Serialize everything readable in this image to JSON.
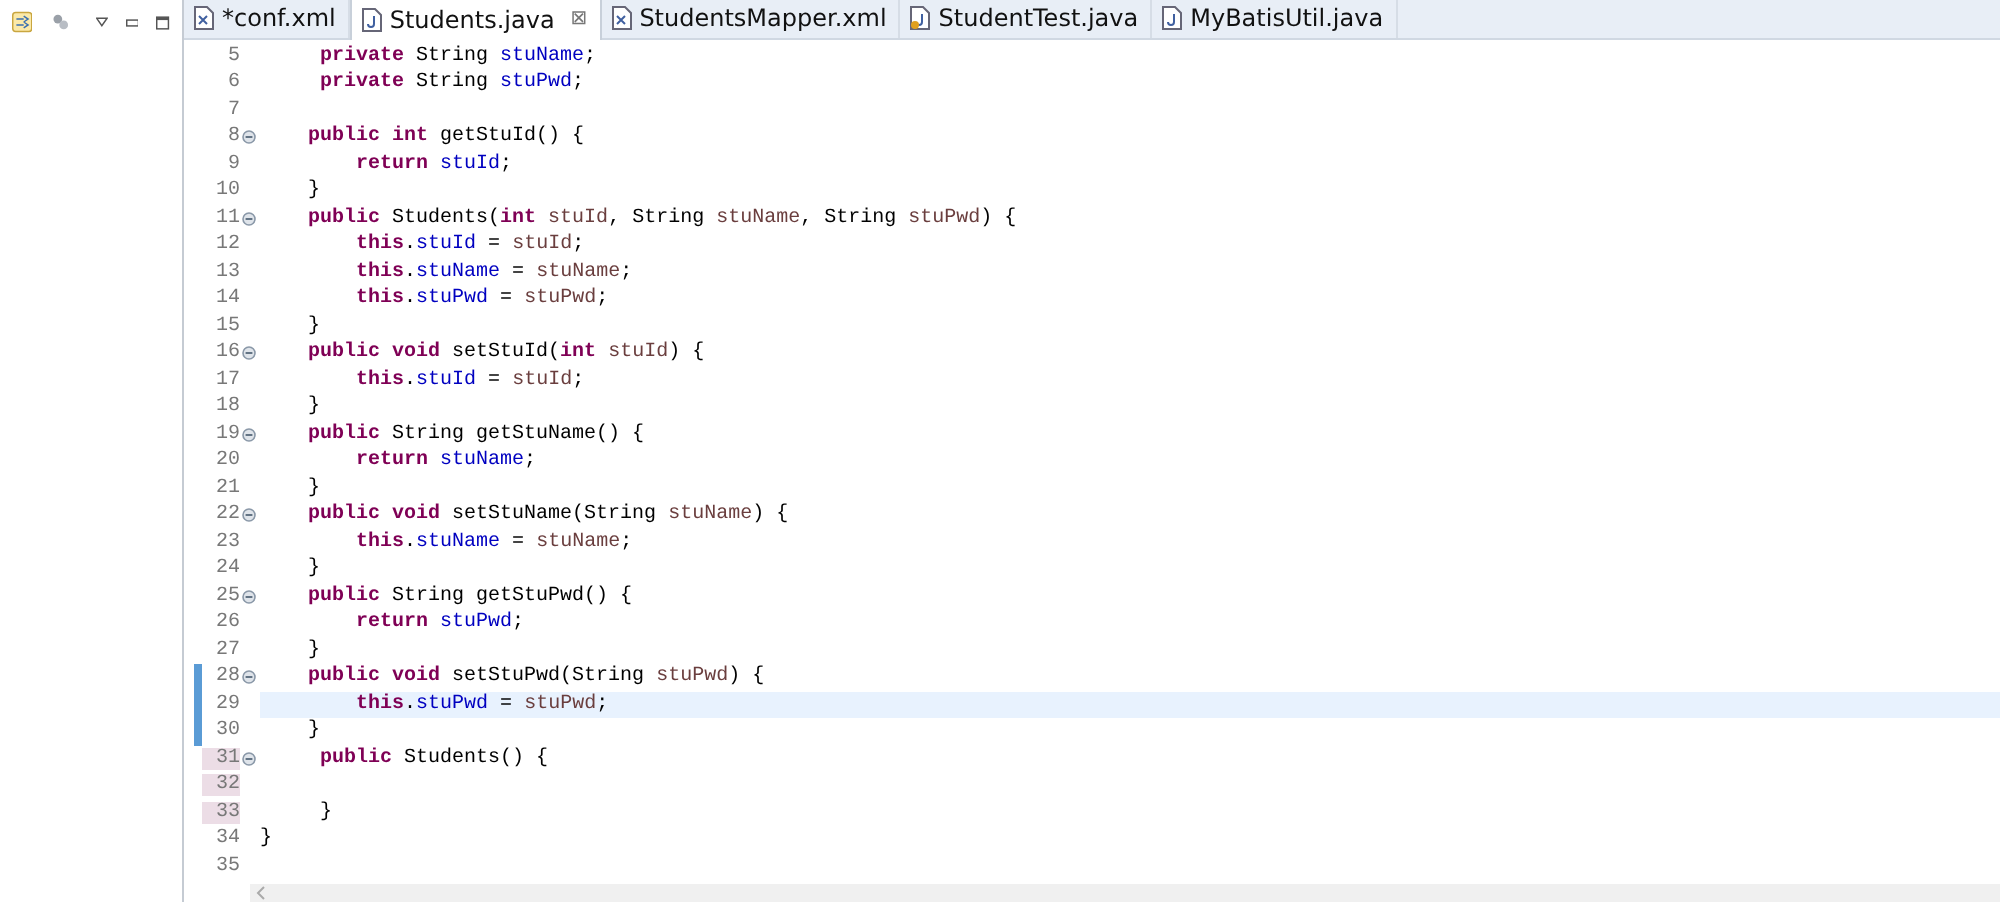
{
  "tabs": [
    {
      "label": "*conf.xml",
      "kind": "xml",
      "selected": false
    },
    {
      "label": "Students.java",
      "kind": "java",
      "selected": true
    },
    {
      "label": "StudentsMapper.xml",
      "kind": "xml",
      "selected": false
    },
    {
      "label": "StudentTest.java",
      "kind": "test",
      "selected": false
    },
    {
      "label": "MyBatisUtil.java",
      "kind": "java",
      "selected": false
    }
  ],
  "close_glyph": "⊠",
  "lines": [
    {
      "n": "5",
      "fold": false,
      "current": false,
      "code": [
        {
          "kind": "keyword",
          "text": "     private"
        },
        {
          "kind": "plain",
          "text": " String "
        },
        {
          "kind": "field",
          "text": "stuName"
        },
        {
          "kind": "plain",
          "text": ";"
        }
      ]
    },
    {
      "n": "6",
      "fold": false,
      "current": false,
      "code": [
        {
          "kind": "keyword",
          "text": "     private"
        },
        {
          "kind": "plain",
          "text": " String "
        },
        {
          "kind": "field",
          "text": "stuPwd"
        },
        {
          "kind": "plain",
          "text": ";"
        }
      ]
    },
    {
      "n": "7",
      "fold": false,
      "current": false
    },
    {
      "n": "8",
      "fold": true,
      "current": false,
      "code": [
        {
          "kind": "keyword",
          "text": "    public "
        },
        {
          "kind": "keyword",
          "text": "int"
        },
        {
          "kind": "plain",
          "text": " getStuId() {"
        }
      ]
    },
    {
      "n": "9",
      "fold": false,
      "current": false,
      "code": [
        {
          "kind": "keyword",
          "text": "        return "
        },
        {
          "kind": "field",
          "text": "stuId"
        },
        {
          "kind": "plain",
          "text": ";"
        }
      ]
    },
    {
      "n": "10",
      "fold": false,
      "current": false,
      "code": [
        {
          "kind": "plain",
          "text": "    }"
        }
      ]
    },
    {
      "n": "11",
      "fold": true,
      "current": false,
      "code": [
        {
          "kind": "keyword",
          "text": "    public"
        },
        {
          "kind": "plain",
          "text": " Students("
        },
        {
          "kind": "keyword",
          "text": "int "
        },
        {
          "kind": "variable",
          "text": "stuId"
        },
        {
          "kind": "plain",
          "text": ", String "
        },
        {
          "kind": "variable",
          "text": "stuName"
        },
        {
          "kind": "plain",
          "text": ", String "
        },
        {
          "kind": "variable",
          "text": "stuPwd"
        },
        {
          "kind": "plain",
          "text": ") {"
        }
      ]
    },
    {
      "n": "12",
      "fold": false,
      "current": false,
      "code": [
        {
          "kind": "keyword",
          "text": "        this"
        },
        {
          "kind": "plain",
          "text": "."
        },
        {
          "kind": "field",
          "text": "stuId"
        },
        {
          "kind": "plain",
          "text": " = "
        },
        {
          "kind": "variable",
          "text": "stuId"
        },
        {
          "kind": "plain",
          "text": ";"
        }
      ]
    },
    {
      "n": "13",
      "fold": false,
      "current": false,
      "code": [
        {
          "kind": "keyword",
          "text": "        this"
        },
        {
          "kind": "plain",
          "text": "."
        },
        {
          "kind": "field",
          "text": "stuName"
        },
        {
          "kind": "plain",
          "text": " = "
        },
        {
          "kind": "variable",
          "text": "stuName"
        },
        {
          "kind": "plain",
          "text": ";"
        }
      ]
    },
    {
      "n": "14",
      "fold": false,
      "current": false,
      "code": [
        {
          "kind": "keyword",
          "text": "        this"
        },
        {
          "kind": "plain",
          "text": "."
        },
        {
          "kind": "field",
          "text": "stuPwd"
        },
        {
          "kind": "plain",
          "text": " = "
        },
        {
          "kind": "variable",
          "text": "stuPwd"
        },
        {
          "kind": "plain",
          "text": ";"
        }
      ]
    },
    {
      "n": "15",
      "fold": false,
      "current": false,
      "code": [
        {
          "kind": "plain",
          "text": "    }"
        }
      ]
    },
    {
      "n": "16",
      "fold": true,
      "current": false,
      "code": [
        {
          "kind": "keyword",
          "text": "    public "
        },
        {
          "kind": "keyword",
          "text": "void"
        },
        {
          "kind": "plain",
          "text": " setStuId("
        },
        {
          "kind": "keyword",
          "text": "int "
        },
        {
          "kind": "variable",
          "text": "stuId"
        },
        {
          "kind": "plain",
          "text": ") {"
        }
      ]
    },
    {
      "n": "17",
      "fold": false,
      "current": false,
      "code": [
        {
          "kind": "keyword",
          "text": "        this"
        },
        {
          "kind": "plain",
          "text": "."
        },
        {
          "kind": "field",
          "text": "stuId"
        },
        {
          "kind": "plain",
          "text": " = "
        },
        {
          "kind": "variable",
          "text": "stuId"
        },
        {
          "kind": "plain",
          "text": ";"
        }
      ]
    },
    {
      "n": "18",
      "fold": false,
      "current": false,
      "code": [
        {
          "kind": "plain",
          "text": "    }"
        }
      ]
    },
    {
      "n": "19",
      "fold": true,
      "current": false,
      "code": [
        {
          "kind": "keyword",
          "text": "    public"
        },
        {
          "kind": "plain",
          "text": " String getStuName() {"
        }
      ]
    },
    {
      "n": "20",
      "fold": false,
      "current": false,
      "code": [
        {
          "kind": "keyword",
          "text": "        return "
        },
        {
          "kind": "field",
          "text": "stuName"
        },
        {
          "kind": "plain",
          "text": ";"
        }
      ]
    },
    {
      "n": "21",
      "fold": false,
      "current": false,
      "code": [
        {
          "kind": "plain",
          "text": "    }"
        }
      ]
    },
    {
      "n": "22",
      "fold": true,
      "current": false,
      "code": [
        {
          "kind": "keyword",
          "text": "    public "
        },
        {
          "kind": "keyword",
          "text": "void"
        },
        {
          "kind": "plain",
          "text": " setStuName(String "
        },
        {
          "kind": "variable",
          "text": "stuName"
        },
        {
          "kind": "plain",
          "text": ") {"
        }
      ]
    },
    {
      "n": "23",
      "fold": false,
      "current": false,
      "code": [
        {
          "kind": "keyword",
          "text": "        this"
        },
        {
          "kind": "plain",
          "text": "."
        },
        {
          "kind": "field",
          "text": "stuName"
        },
        {
          "kind": "plain",
          "text": " = "
        },
        {
          "kind": "variable",
          "text": "stuName"
        },
        {
          "kind": "plain",
          "text": ";"
        }
      ]
    },
    {
      "n": "24",
      "fold": false,
      "current": false,
      "code": [
        {
          "kind": "plain",
          "text": "    }"
        }
      ]
    },
    {
      "n": "25",
      "fold": true,
      "current": false,
      "code": [
        {
          "kind": "keyword",
          "text": "    public"
        },
        {
          "kind": "plain",
          "text": " String getStuPwd() {"
        }
      ]
    },
    {
      "n": "26",
      "fold": false,
      "current": false,
      "code": [
        {
          "kind": "keyword",
          "text": "        return "
        },
        {
          "kind": "field",
          "text": "stuPwd"
        },
        {
          "kind": "plain",
          "text": ";"
        }
      ]
    },
    {
      "n": "27",
      "fold": false,
      "current": false,
      "code": [
        {
          "kind": "plain",
          "text": "    }"
        }
      ]
    },
    {
      "n": "28",
      "fold": true,
      "current": false,
      "kind": "modified",
      "code": [
        {
          "kind": "keyword",
          "text": "    public "
        },
        {
          "kind": "keyword",
          "text": "void"
        },
        {
          "kind": "plain",
          "text": " setStuPwd(String "
        },
        {
          "kind": "variable",
          "text": "stuPwd"
        },
        {
          "kind": "plain",
          "text": ") {"
        }
      ]
    },
    {
      "n": "29",
      "fold": false,
      "current": true,
      "kind": "modified",
      "code": [
        {
          "kind": "keyword",
          "text": "        this"
        },
        {
          "kind": "plain",
          "text": "."
        },
        {
          "kind": "field",
          "text": "stuPwd"
        },
        {
          "kind": "plain",
          "text": " = "
        },
        {
          "kind": "variable",
          "text": "stuPwd"
        },
        {
          "kind": "plain",
          "text": ";"
        }
      ]
    },
    {
      "n": "30",
      "fold": false,
      "current": false,
      "kind": "modified",
      "code": [
        {
          "kind": "plain",
          "text": "    }"
        }
      ]
    },
    {
      "n": "31",
      "fold": true,
      "current": false,
      "kind": "added",
      "code": [
        {
          "kind": "keyword",
          "text": "     public"
        },
        {
          "kind": "plain",
          "text": " Students() {"
        }
      ]
    },
    {
      "n": "32",
      "fold": false,
      "current": false,
      "kind": "added"
    },
    {
      "n": "33",
      "fold": false,
      "current": false,
      "kind": "added",
      "code": [
        {
          "kind": "plain",
          "text": "     }"
        }
      ]
    },
    {
      "n": "34",
      "fold": false,
      "current": false,
      "code": [
        {
          "kind": "plain",
          "text": "}"
        }
      ]
    },
    {
      "n": "35",
      "fold": false,
      "current": false
    }
  ]
}
